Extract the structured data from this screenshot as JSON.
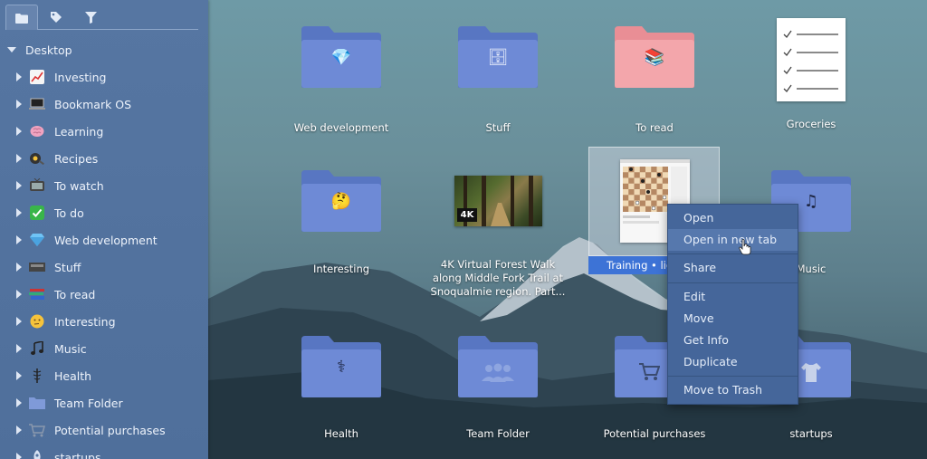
{
  "sidebar": {
    "tabs": [
      {
        "icon": "folder-icon"
      },
      {
        "icon": "tag-icon"
      },
      {
        "icon": "filter-icon"
      }
    ],
    "root_label": "Desktop",
    "items": [
      {
        "label": "Investing",
        "icon": "chart-increasing-icon"
      },
      {
        "label": "Bookmark OS",
        "icon": "laptop-icon"
      },
      {
        "label": "Learning",
        "icon": "brain-icon"
      },
      {
        "label": "Recipes",
        "icon": "frying-pan-icon"
      },
      {
        "label": "To watch",
        "icon": "tv-icon"
      },
      {
        "label": "To do",
        "icon": "check-mark-icon"
      },
      {
        "label": "Web development",
        "icon": "gem-icon"
      },
      {
        "label": "Stuff",
        "icon": "box-icon"
      },
      {
        "label": "To read",
        "icon": "books-icon"
      },
      {
        "label": "Interesting",
        "icon": "thinking-face-icon"
      },
      {
        "label": "Music",
        "icon": "music-note-icon"
      },
      {
        "label": "Health",
        "icon": "caduceus-icon"
      },
      {
        "label": "Team Folder",
        "icon": "folder-icon"
      },
      {
        "label": "Potential purchases",
        "icon": "cart-icon"
      },
      {
        "label": "startups",
        "icon": "rocket-icon"
      }
    ]
  },
  "grid": {
    "tiles": [
      {
        "label": "Web development",
        "type": "folder"
      },
      {
        "label": "Stuff",
        "type": "folder"
      },
      {
        "label": "To read",
        "type": "folder-pink"
      },
      {
        "label": "Groceries",
        "type": "checklist"
      },
      {
        "label": "Interesting",
        "type": "folder"
      },
      {
        "label": "4K Virtual Forest Walk along Middle Fork Trail at Snoqualmie region. Part...",
        "type": "video-thumbnail",
        "badge": "4K"
      },
      {
        "label": "Training • lich",
        "type": "webpage-thumbnail"
      },
      {
        "label": "Music",
        "type": "folder"
      },
      {
        "label": "Health",
        "type": "folder"
      },
      {
        "label": "Team Folder",
        "type": "folder"
      },
      {
        "label": "Potential purchases",
        "type": "folder"
      },
      {
        "label": "startups",
        "type": "folder"
      }
    ]
  },
  "context_menu": {
    "items": [
      {
        "label": "Open"
      },
      {
        "label": "Open in new tab",
        "highlighted": true
      },
      {
        "label": "Share"
      },
      {
        "label": "Edit"
      },
      {
        "label": "Move"
      },
      {
        "label": "Get Info"
      },
      {
        "label": "Duplicate"
      },
      {
        "label": "Move to Trash"
      }
    ]
  },
  "colors": {
    "sidebar": "#5676a2",
    "folder": "#6482cc",
    "folder_pink": "#f3a6ab",
    "selection": "#3d73d6",
    "menu": "#45669a",
    "menu_highlight": "#5678ad"
  }
}
